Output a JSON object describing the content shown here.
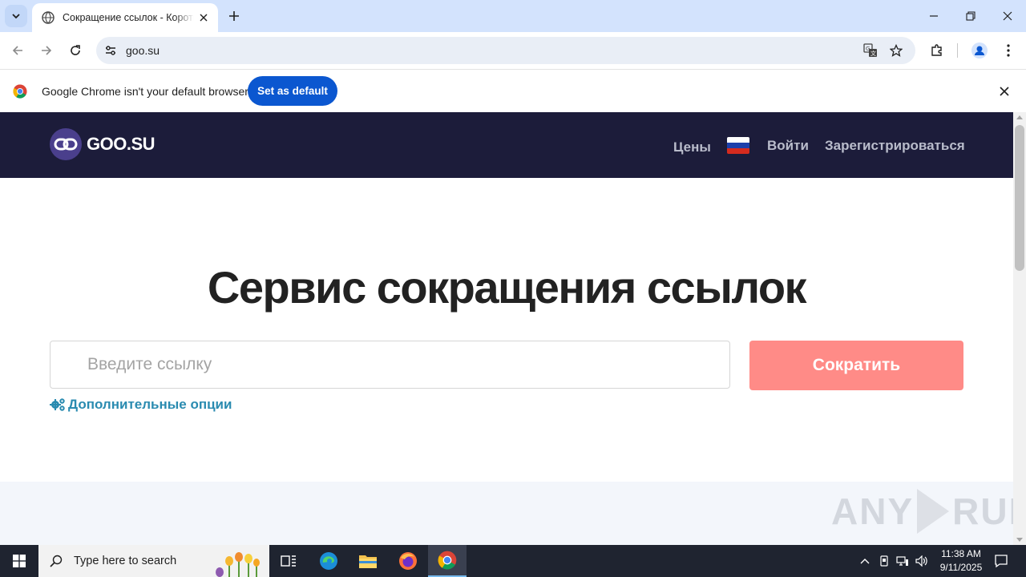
{
  "browser": {
    "tab_title": "Сокращение ссылок - Короткая ссылка",
    "url": "goo.su",
    "infobar_text": "Google Chrome isn't your default browser",
    "infobar_button": "Set as default"
  },
  "site": {
    "logo_text": "GOO.SU",
    "nav": {
      "prices": "Цены",
      "login": "Войти",
      "register": "Зарегистрироваться"
    },
    "hero_title": "Сервис сокращения ссылок",
    "url_placeholder": "Введите ссылку",
    "url_value": "",
    "shorten_button": "Сократить",
    "options_link": "Дополнительные опции",
    "watermark_left": "ANY",
    "watermark_right": "RUN"
  },
  "taskbar": {
    "search_placeholder": "Type here to search",
    "time": "11:38 AM",
    "date": "9/11/2025"
  },
  "colors": {
    "site_header": "#1c1c3a",
    "shorten_button": "#ff8b87",
    "options_link": "#2a8bb0",
    "chrome_accent": "#0b57d0"
  }
}
